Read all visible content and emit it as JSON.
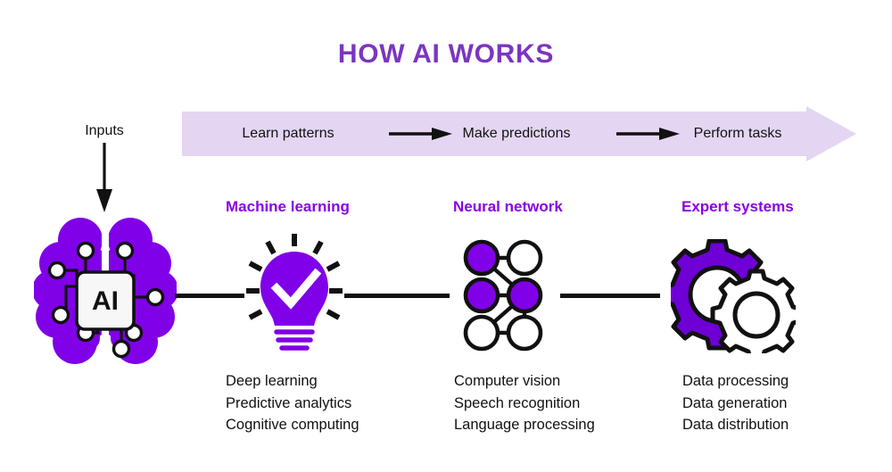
{
  "page": {
    "title": "HOW AI WORKS",
    "title_color": "#7B35C0",
    "accent_color": "#8A00E8",
    "banner_color": "#E4D6F2",
    "line_color": "#111111",
    "background": "#FFFFFF"
  },
  "input": {
    "label": "Inputs",
    "arrow_icon": "arrow-down-icon"
  },
  "banner": {
    "stages": [
      {
        "label": "Learn patterns"
      },
      {
        "label": "Make predictions"
      },
      {
        "label": "Perform tasks"
      }
    ],
    "arrows": [
      {
        "icon": "arrow-right-icon"
      },
      {
        "icon": "arrow-right-icon"
      }
    ],
    "shape": "right-pointing-arrow-banner"
  },
  "core": {
    "icon": "brain-chip-icon",
    "chip_label": "AI"
  },
  "columns": [
    {
      "heading": "Machine learning",
      "icon": "lightbulb-check-icon",
      "items": [
        "Deep learning",
        "Predictive analytics",
        "Cognitive computing"
      ]
    },
    {
      "heading": "Neural network",
      "icon": "neural-network-icon",
      "items": [
        "Computer vision",
        "Speech recognition",
        "Language processing"
      ]
    },
    {
      "heading": "Expert systems",
      "icon": "gears-icon",
      "items": [
        "Data processing",
        "Data generation",
        "Data distribution"
      ]
    }
  ]
}
